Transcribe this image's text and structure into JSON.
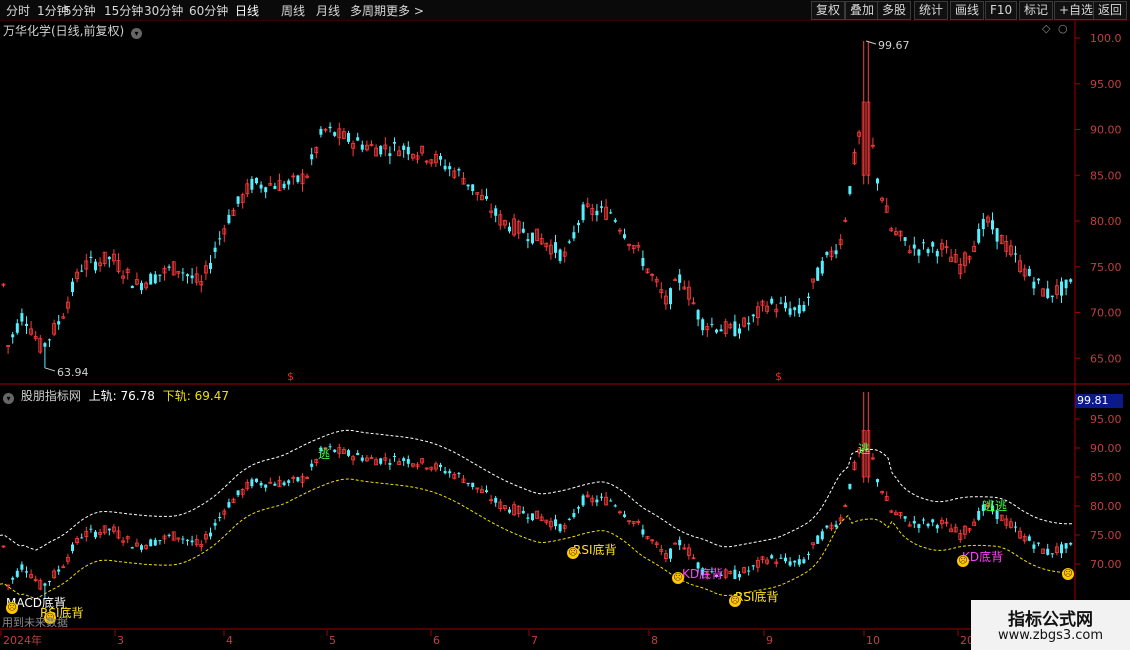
{
  "toolbar": {
    "periods": [
      "分时",
      "1分钟",
      "5分钟",
      "15分钟",
      "30分钟",
      "60分钟",
      "日线",
      "周线",
      "月线",
      "多周期",
      "更多 >"
    ],
    "active": "日线",
    "right_buttons": [
      "复权",
      "叠加",
      "多股",
      "统计",
      "画线",
      "F10",
      "标记",
      "+自选",
      "返回"
    ]
  },
  "main_panel": {
    "title": "万华化学(日线,前复权)",
    "high_label": "99.67",
    "low_label": "63.94",
    "y_ticks": [
      "100.0",
      "95.00",
      "90.00",
      "85.00",
      "80.00",
      "75.00",
      "70.00",
      "65.00"
    ],
    "markers": [
      "$",
      "$"
    ]
  },
  "indicator_panel": {
    "name": "股朋指标网",
    "upper_label": "上轨:",
    "upper_value": "76.78",
    "lower_label": "下轨:",
    "lower_value": "69.47",
    "price_tag": "99.81",
    "y_ticks": [
      "95.00",
      "90.00",
      "85.00",
      "80.00",
      "75.00",
      "70.00"
    ],
    "signals": {
      "escape1": "逃",
      "escape2": "逃",
      "escape3": "逃逃",
      "rsi1": "RSI底背",
      "macd": "MACD底背",
      "rsi2": "RSI底背",
      "kd1": "KD底背",
      "rsi3": "RSI底背",
      "kd2": "KD底背"
    },
    "footer_note": "用到未来数据"
  },
  "x_axis": {
    "labels": [
      "2024年",
      "3",
      "4",
      "5",
      "6",
      "7",
      "8",
      "9",
      "10",
      "20"
    ]
  },
  "watermark": {
    "line1": "指标公式网",
    "line2": "www.zbgs3.com"
  },
  "colors": {
    "up": "#ff3b3b",
    "down": "#54f0ff",
    "upper_band": "#ffffff",
    "lower_band": "#f0e000",
    "axis": "#a00000"
  }
}
